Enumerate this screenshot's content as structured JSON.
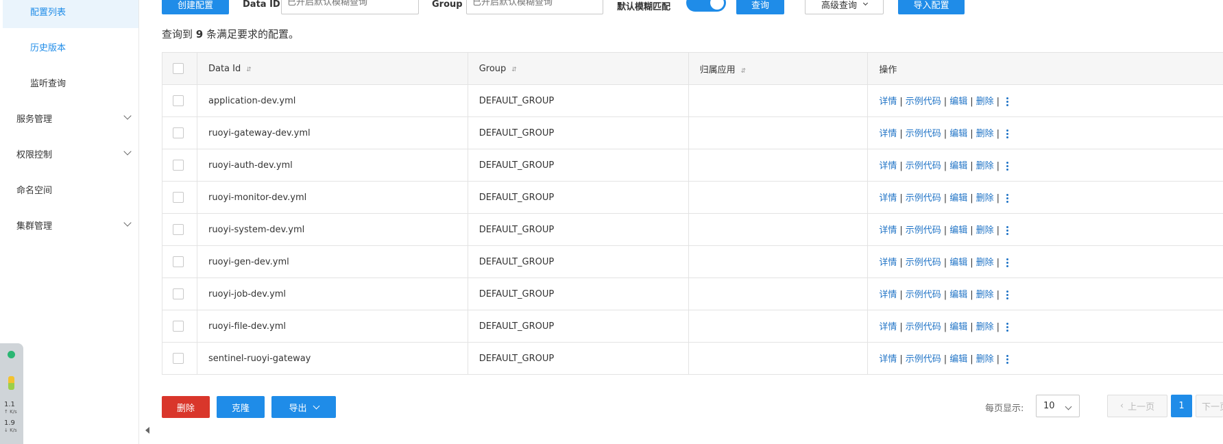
{
  "sidebar": {
    "items": [
      {
        "label": "配置列表"
      },
      {
        "label": "历史版本"
      },
      {
        "label": "监听查询"
      },
      {
        "label": "服务管理"
      },
      {
        "label": "权限控制"
      },
      {
        "label": "命名空间"
      },
      {
        "label": "集群管理"
      }
    ]
  },
  "widget": {
    "up_speed": "1.1",
    "up_unit": "K/s",
    "down_speed": "1.9",
    "down_unit": "K/s"
  },
  "toolbar": {
    "create_label": "创建配置",
    "dataid_label": "Data ID",
    "dataid_placeholder": "已开启默认模糊查询",
    "group_label": "Group",
    "group_placeholder": "已开启默认模糊查询",
    "fuzzy_label": "默认模糊匹配",
    "fuzzy_on": true,
    "query_label": "查询",
    "advanced_label": "高级查询",
    "import_label": "导入配置"
  },
  "summary": {
    "prefix": "查询到",
    "count": "9",
    "suffix": "条满足要求的配置。"
  },
  "table": {
    "headers": {
      "dataid": "Data Id",
      "group": "Group",
      "app": "归属应用",
      "ops": "操作"
    },
    "ops": {
      "detail": "详情",
      "sample": "示例代码",
      "edit": "编辑",
      "delete": "删除",
      "separator": "|"
    },
    "rows": [
      {
        "dataid": "application-dev.yml",
        "group": "DEFAULT_GROUP",
        "app": ""
      },
      {
        "dataid": "ruoyi-gateway-dev.yml",
        "group": "DEFAULT_GROUP",
        "app": ""
      },
      {
        "dataid": "ruoyi-auth-dev.yml",
        "group": "DEFAULT_GROUP",
        "app": ""
      },
      {
        "dataid": "ruoyi-monitor-dev.yml",
        "group": "DEFAULT_GROUP",
        "app": ""
      },
      {
        "dataid": "ruoyi-system-dev.yml",
        "group": "DEFAULT_GROUP",
        "app": ""
      },
      {
        "dataid": "ruoyi-gen-dev.yml",
        "group": "DEFAULT_GROUP",
        "app": ""
      },
      {
        "dataid": "ruoyi-job-dev.yml",
        "group": "DEFAULT_GROUP",
        "app": ""
      },
      {
        "dataid": "ruoyi-file-dev.yml",
        "group": "DEFAULT_GROUP",
        "app": ""
      },
      {
        "dataid": "sentinel-ruoyi-gateway",
        "group": "DEFAULT_GROUP",
        "app": ""
      }
    ]
  },
  "footer": {
    "delete_label": "删除",
    "clone_label": "克隆",
    "export_label": "导出",
    "page_size_label": "每页显示:",
    "page_size": "10",
    "prev_label": "上一页",
    "current_page": "1",
    "next_label": "下一页"
  },
  "colors": {
    "primary": "#1f8ce8",
    "danger": "#d9362b",
    "link": "#1f73c6"
  }
}
